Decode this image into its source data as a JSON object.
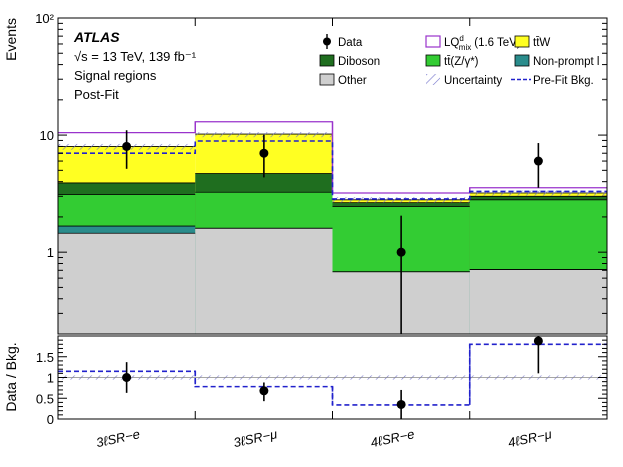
{
  "chart_data": {
    "type": "bar",
    "categories": [
      "3ℓSR−e",
      "3ℓSR−μ",
      "4ℓSR−e",
      "4ℓSR−μ"
    ],
    "ylabel": "Events",
    "yscale": "log",
    "ylim": [
      0.2,
      100
    ],
    "yticks": [
      {
        "v": 1,
        "label": "1"
      },
      {
        "v": 10,
        "label": "10"
      },
      {
        "v": 100,
        "label": "10²"
      }
    ],
    "info": {
      "experiment": "ATLAS",
      "energy": "√s = 13 TeV, 139 fb⁻¹",
      "region": "Signal regions",
      "fit": "Post-Fit"
    },
    "colors": {
      "other": "#cfcfcf",
      "nonprompt": "#2a8c8c",
      "ttz": "#33cc33",
      "diboson": "#1f6e1f",
      "ttw": "#ffff22",
      "signal": "#9933cc",
      "prefit": "#2222cc",
      "uncertainty": "#7777cc"
    },
    "stack_order": [
      "Other",
      "Non-prompt l",
      "tt̄(Z/γ*)",
      "Diboson",
      "tt̄W"
    ],
    "stack_cumulative": {
      "Other": [
        1.45,
        1.6,
        0.68,
        0.71
      ],
      "Non-prompt l": [
        1.67,
        1.6,
        0.68,
        0.71
      ],
      "tt̄(Z/γ*)": [
        3.1,
        3.25,
        2.45,
        2.8
      ],
      "Diboson": [
        3.9,
        4.7,
        2.65,
        3.0
      ],
      "tt̄W": [
        8.0,
        10.2,
        2.8,
        3.2
      ]
    },
    "uncertainty_band": [
      [
        7.5,
        8.4
      ],
      [
        9.6,
        10.6
      ],
      [
        2.65,
        2.95
      ],
      [
        3.05,
        3.35
      ]
    ],
    "signal_total": [
      10.5,
      13.0,
      3.2,
      3.55
    ],
    "prefit_total": [
      7.0,
      8.9,
      2.85,
      3.3
    ],
    "data": {
      "values": [
        8.0,
        7.0,
        1.0,
        6.0
      ],
      "err_low": [
        2.85,
        2.65,
        1.0,
        2.45
      ],
      "err_high": [
        3.0,
        3.05,
        1.05,
        2.55
      ]
    },
    "legend": [
      {
        "key": "data",
        "label": "Data"
      },
      {
        "key": "signal",
        "label": "LQ"
      },
      {
        "key": "ttw",
        "label": "tt̄W"
      },
      {
        "key": "diboson",
        "label": "Diboson"
      },
      {
        "key": "ttz",
        "label": "tt̄(Z/γ*)"
      },
      {
        "key": "nonprompt",
        "label": "Non-prompt l"
      },
      {
        "key": "other",
        "label": "Other"
      },
      {
        "key": "uncertainty",
        "label": "Uncertainty"
      },
      {
        "key": "prefit",
        "label": "Pre-Fit Bkg."
      }
    ],
    "legend_signal_detail": {
      "sup": "d",
      "sub": "mix",
      "mass": "(1.6 TeV)"
    },
    "ratio": {
      "ylabel": "Data / Bkg.",
      "ylim": [
        0,
        2.0
      ],
      "yticks": [
        0,
        0.5,
        1,
        1.5
      ],
      "values": [
        1.0,
        0.68,
        0.35,
        1.88
      ],
      "err_low": [
        0.37,
        0.25,
        0.35,
        0.78
      ],
      "err_high": [
        0.37,
        0.2,
        0.35,
        0.78
      ],
      "prefit_ratio": [
        1.15,
        0.78,
        0.34,
        1.8
      ],
      "band": [
        [
          0.95,
          1.05
        ],
        [
          0.95,
          1.05
        ],
        [
          0.95,
          1.05
        ],
        [
          0.95,
          1.05
        ]
      ]
    }
  }
}
